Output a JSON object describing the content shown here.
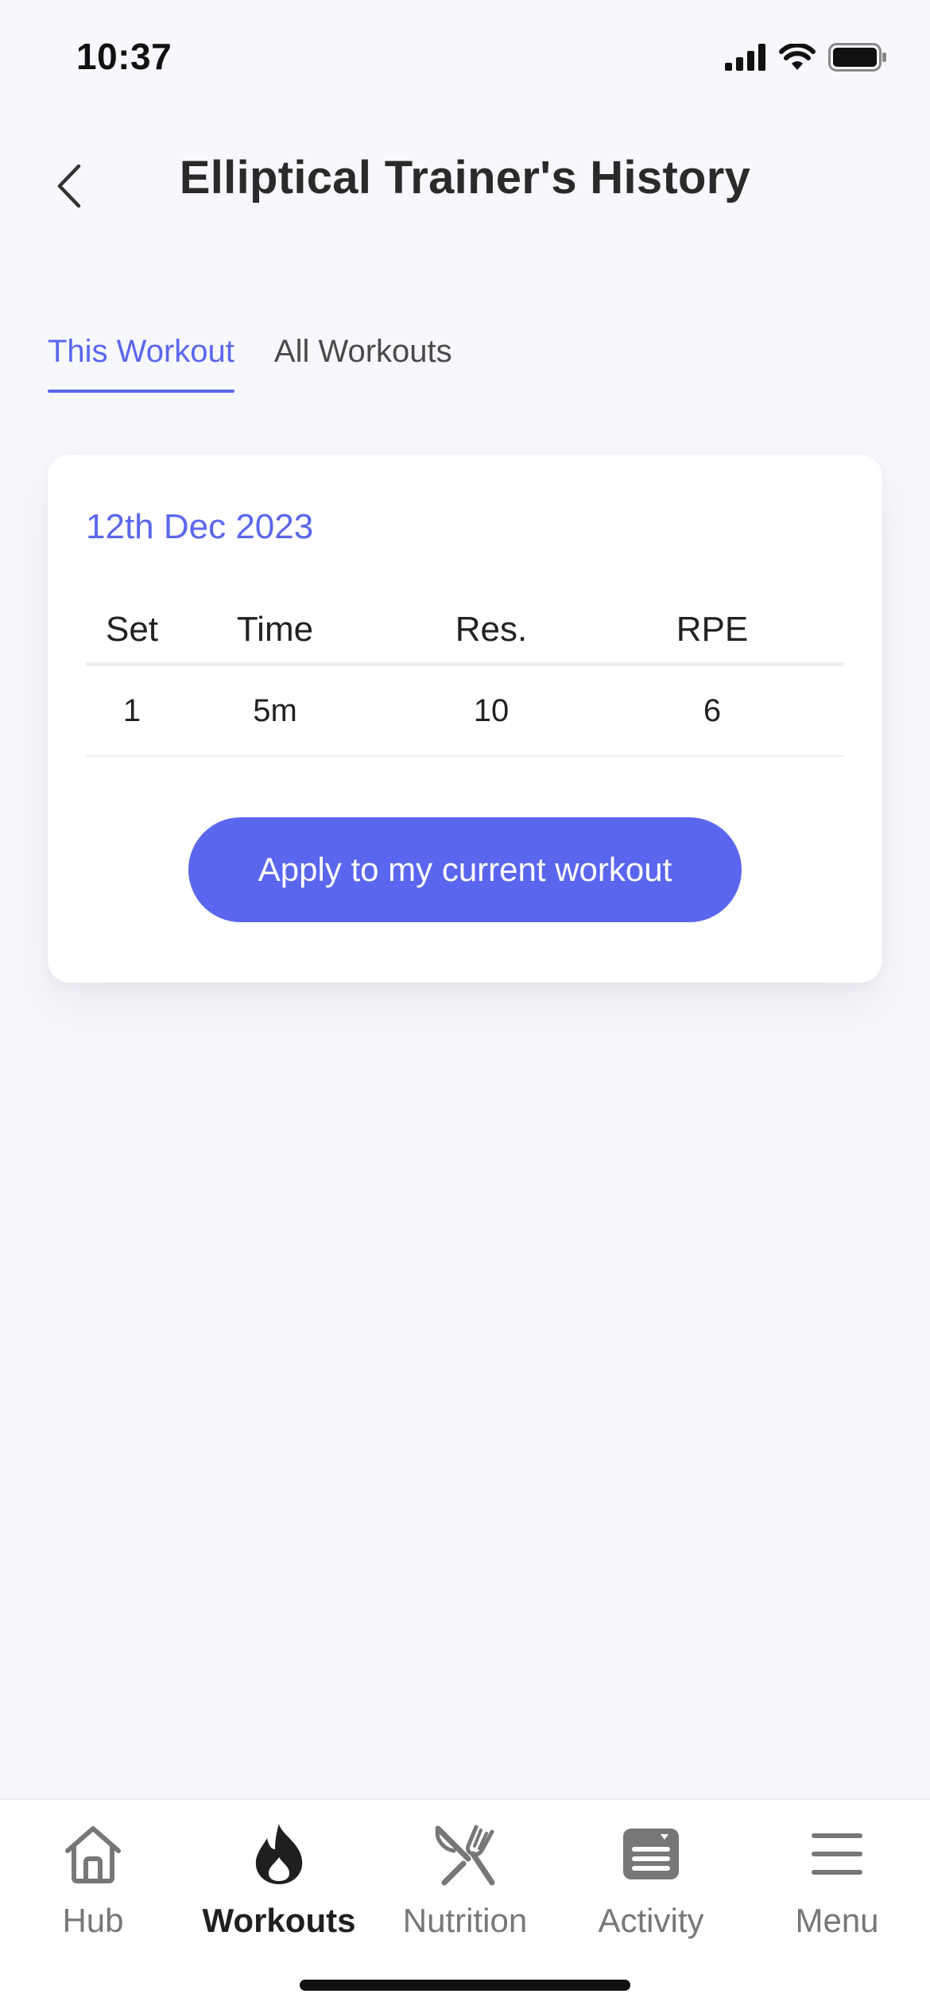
{
  "status_bar": {
    "time": "10:37",
    "icons": [
      "cellular-signal-icon",
      "wifi-icon",
      "battery-icon"
    ]
  },
  "header": {
    "title": "Elliptical Trainer's History",
    "back_icon": "chevron-left-icon"
  },
  "tabs": [
    {
      "label": "This Workout",
      "active": true
    },
    {
      "label": "All Workouts",
      "active": false
    }
  ],
  "card": {
    "date": "12th Dec 2023",
    "columns": [
      "Set",
      "Time",
      "Res.",
      "RPE"
    ],
    "rows": [
      [
        "1",
        "5m",
        "10",
        "6"
      ]
    ],
    "apply_label": "Apply to my current workout"
  },
  "bottom_nav": {
    "items": [
      {
        "label": "Hub",
        "icon": "home-icon",
        "active": false
      },
      {
        "label": "Workouts",
        "icon": "flame-icon",
        "active": true
      },
      {
        "label": "Nutrition",
        "icon": "fork-knife-icon",
        "active": false
      },
      {
        "label": "Activity",
        "icon": "newspaper-icon",
        "active": false
      },
      {
        "label": "Menu",
        "icon": "hamburger-menu-icon",
        "active": false
      }
    ]
  },
  "colors": {
    "accent": "#5b66ee",
    "background": "#f7f8fc",
    "card": "#ffffff",
    "text": "#222222",
    "nav_inactive": "#777777"
  }
}
